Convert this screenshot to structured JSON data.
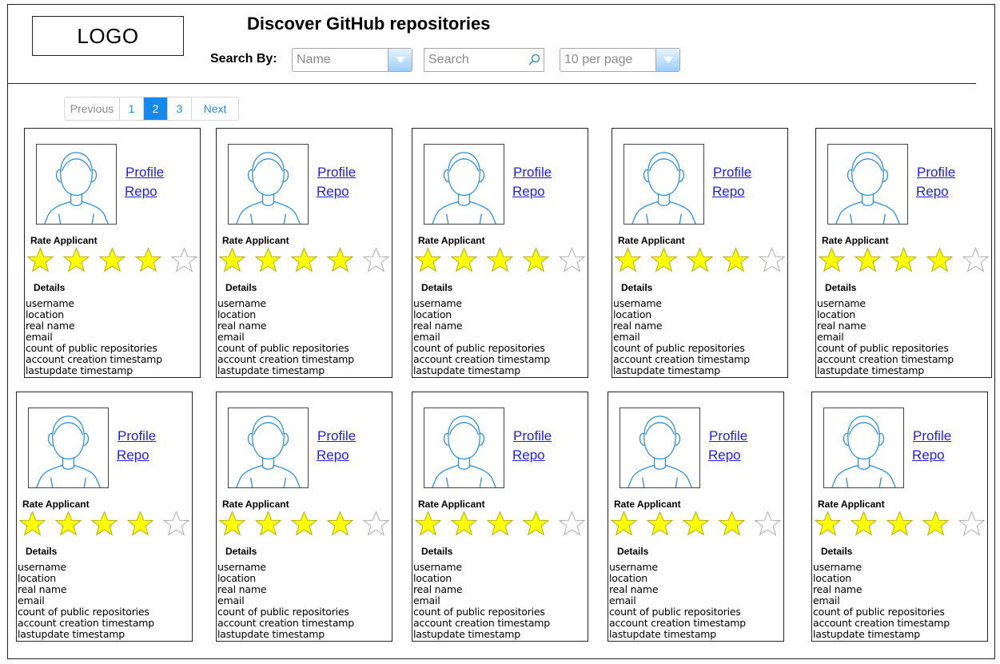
{
  "header": {
    "logo": "LOGO",
    "title": "Discover GitHub repositories",
    "search_by_label": "Search By:",
    "search_field_select": "Name",
    "search_placeholder": "Search",
    "per_page_select": "10 per page"
  },
  "pagination": {
    "previous": "Previous",
    "pages": [
      "1",
      "2",
      "3"
    ],
    "active_page": "2",
    "next": "Next"
  },
  "colors": {
    "link": "#1e1ee6",
    "pagination_active": "#1589ee",
    "star_filled": "#ffff00",
    "avatar_stroke": "#2b8fde"
  },
  "cards": [
    {
      "profile_link": "Profile",
      "repo_link": "Repo",
      "rate_label": "Rate Applicant",
      "rating": 4,
      "max_rating": 5,
      "details_label": "Details",
      "details": [
        "username",
        "location",
        "real name",
        "email",
        "count of public repositories",
        "account creation timestamp",
        "lastupdate timestamp"
      ]
    },
    {
      "profile_link": "Profile",
      "repo_link": "Repo",
      "rate_label": "Rate Applicant",
      "rating": 4,
      "max_rating": 5,
      "details_label": "Details",
      "details": [
        "username",
        "location",
        "real name",
        "email",
        "count of public repositories",
        "account creation timestamp",
        "lastupdate timestamp"
      ]
    },
    {
      "profile_link": "Profile",
      "repo_link": "Repo",
      "rate_label": "Rate Applicant",
      "rating": 4,
      "max_rating": 5,
      "details_label": "Details",
      "details": [
        "username",
        "location",
        "real name",
        "email",
        "count of public repositories",
        "account creation timestamp",
        "lastupdate timestamp"
      ]
    },
    {
      "profile_link": "Profile",
      "repo_link": "Repo",
      "rate_label": "Rate Applicant",
      "rating": 4,
      "max_rating": 5,
      "details_label": "Details",
      "details": [
        "username",
        "location",
        "real name",
        "email",
        "count of public repositories",
        "account creation timestamp",
        "lastupdate timestamp"
      ]
    },
    {
      "profile_link": "Profile",
      "repo_link": "Repo",
      "rate_label": "Rate Applicant",
      "rating": 4,
      "max_rating": 5,
      "details_label": "Details",
      "details": [
        "username",
        "location",
        "real name",
        "email",
        "count of public repositories",
        "account creation timestamp",
        "lastupdate timestamp"
      ]
    },
    {
      "profile_link": "Profile",
      "repo_link": "Repo",
      "rate_label": "Rate Applicant",
      "rating": 4,
      "max_rating": 5,
      "details_label": "Details",
      "details": [
        "username",
        "location",
        "real name",
        "email",
        "count of public repositories",
        "account creation timestamp",
        "lastupdate timestamp"
      ]
    },
    {
      "profile_link": "Profile",
      "repo_link": "Repo",
      "rate_label": "Rate Applicant",
      "rating": 4,
      "max_rating": 5,
      "details_label": "Details",
      "details": [
        "username",
        "location",
        "real name",
        "email",
        "count of public repositories",
        "account creation timestamp",
        "lastupdate timestamp"
      ]
    },
    {
      "profile_link": "Profile",
      "repo_link": "Repo",
      "rate_label": "Rate Applicant",
      "rating": 4,
      "max_rating": 5,
      "details_label": "Details",
      "details": [
        "username",
        "location",
        "real name",
        "email",
        "count of public repositories",
        "account creation timestamp",
        "lastupdate timestamp"
      ]
    },
    {
      "profile_link": "Profile",
      "repo_link": "Repo",
      "rate_label": "Rate Applicant",
      "rating": 4,
      "max_rating": 5,
      "details_label": "Details",
      "details": [
        "username",
        "location",
        "real name",
        "email",
        "count of public repositories",
        "account creation timestamp",
        "lastupdate timestamp"
      ]
    },
    {
      "profile_link": "Profile",
      "repo_link": "Repo",
      "rate_label": "Rate Applicant",
      "rating": 4,
      "max_rating": 5,
      "details_label": "Details",
      "details": [
        "username",
        "location",
        "real name",
        "email",
        "count of public repositories",
        "account creation timestamp",
        "lastupdate timestamp"
      ]
    }
  ]
}
